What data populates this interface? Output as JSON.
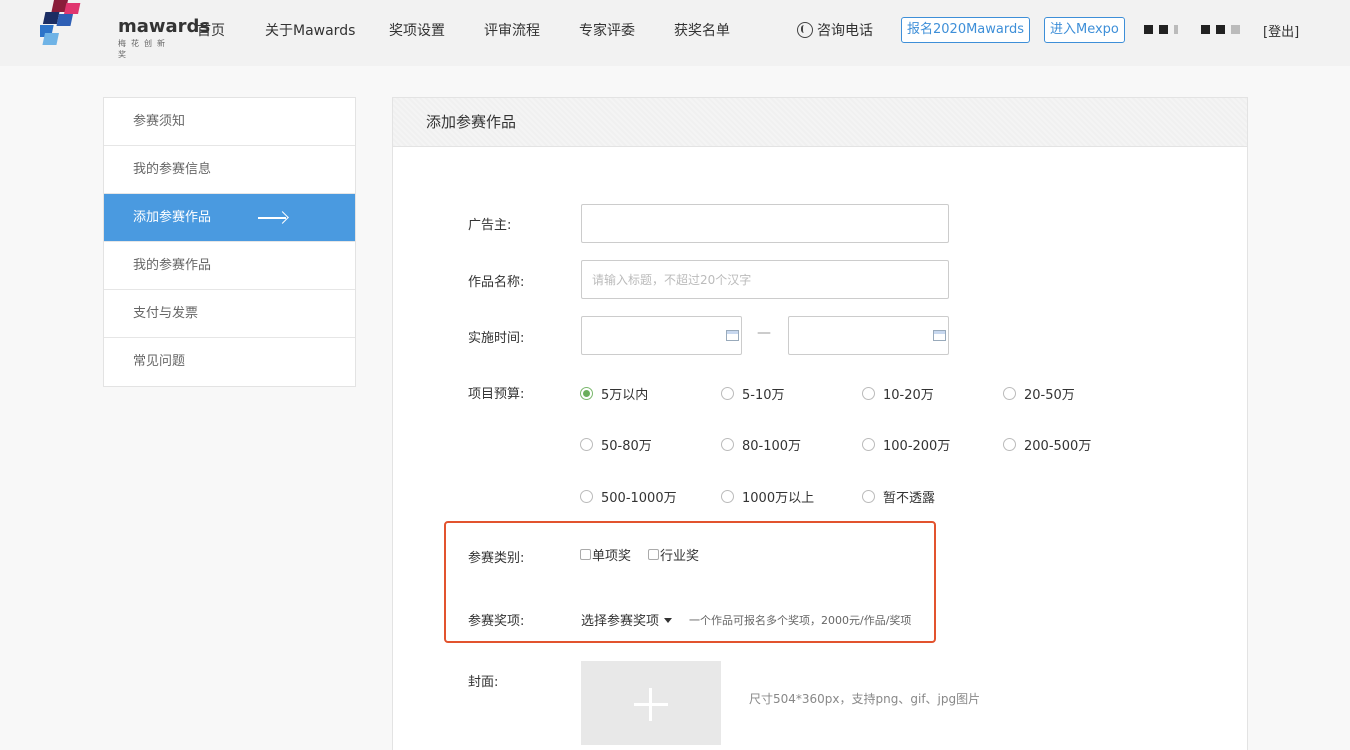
{
  "header": {
    "logo_text": "mawards",
    "logo_sub": "梅花创新奖",
    "nav": [
      "首页",
      "关于Mawards",
      "奖项设置",
      "评审流程",
      "专家评委",
      "获奖名单"
    ],
    "phone_label": "咨询电话",
    "register_button": "报名2020Mawards",
    "mexpo_button": "进入Mexpo",
    "logout": "[登出]"
  },
  "sidebar": {
    "items": [
      "参赛须知",
      "我的参赛信息",
      "添加参赛作品",
      "我的参赛作品",
      "支付与发票",
      "常见问题"
    ],
    "active_index": 2
  },
  "panel": {
    "title": "添加参赛作品",
    "advertiser_label": "广告主:",
    "advertiser_value": "",
    "work_name_label": "作品名称:",
    "work_name_placeholder": "请输入标题，不超过20个汉字",
    "time_label": "实施时间:",
    "time_separator": "—",
    "budget_label": "项目预算:",
    "budget_options": [
      "5万以内",
      "5-10万",
      "10-20万",
      "20-50万",
      "50-80万",
      "80-100万",
      "100-200万",
      "200-500万",
      "500-1000万",
      "1000万以上",
      "暂不透露"
    ],
    "budget_selected": "5万以内",
    "category_label": "参赛类别:",
    "category_options": [
      "单项奖",
      "行业奖"
    ],
    "award_label": "参赛奖项:",
    "award_dropdown": "选择参赛奖项",
    "award_hint": "一个作品可报名多个奖项，2000元/作品/奖项",
    "cover_label": "封面:",
    "cover_hint": "尺寸504*360px，支持png、gif、jpg图片"
  },
  "colors": {
    "accent_blue": "#4a9ae0",
    "highlight_red": "#e2532e",
    "radio_green": "#6aae5c"
  }
}
